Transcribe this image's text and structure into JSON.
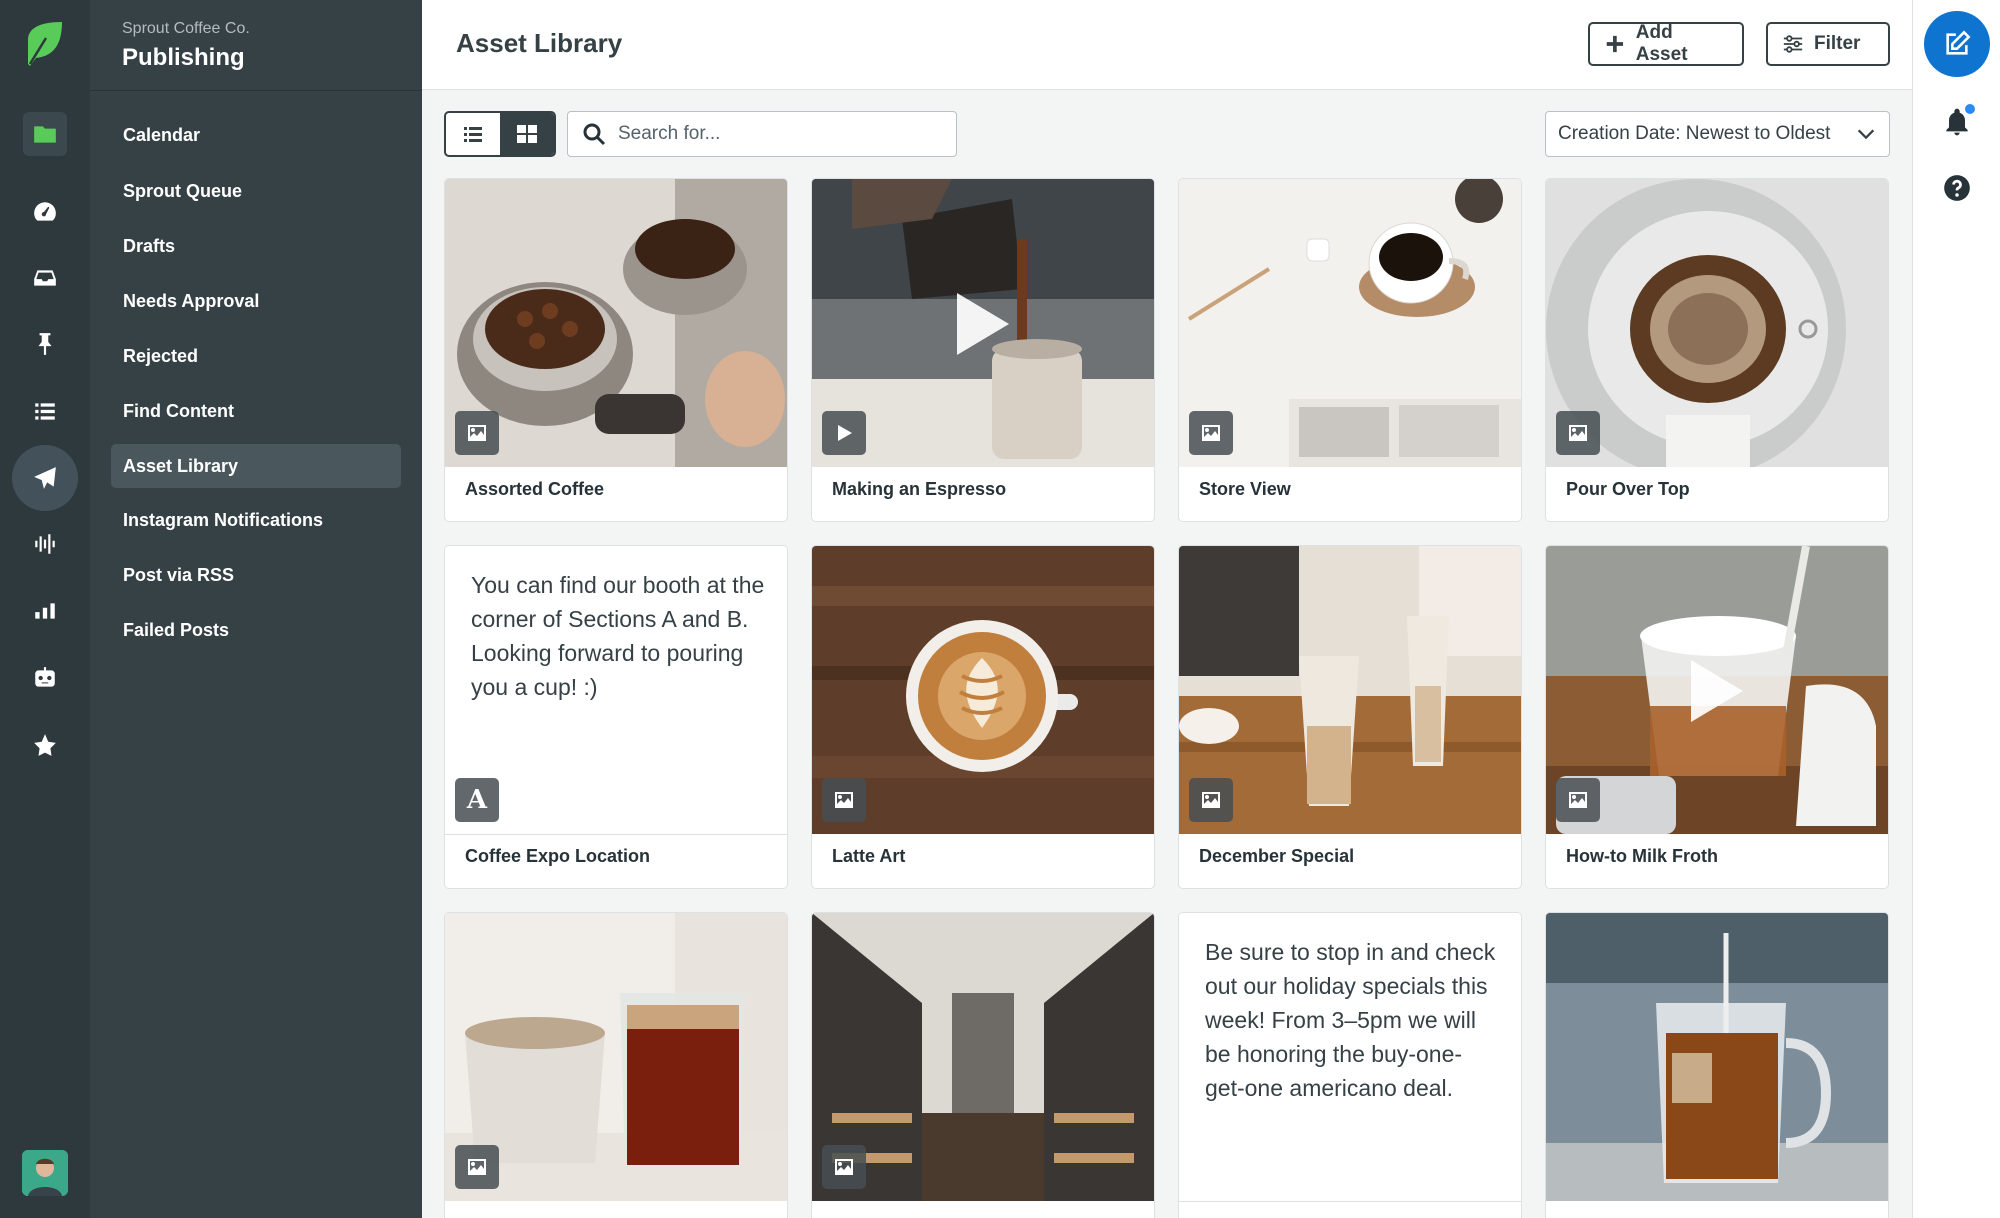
{
  "app": {
    "org_name": "Sprout Coffee Co.",
    "section_title": "Publishing"
  },
  "rail": {
    "icons": [
      "folder-icon",
      "dashboard-icon",
      "inbox-icon",
      "pin-icon",
      "list-icon",
      "send-icon",
      "listening-icon",
      "reports-icon",
      "bot-icon",
      "star-icon"
    ]
  },
  "nav": {
    "items": [
      {
        "label": "Calendar"
      },
      {
        "label": "Sprout Queue"
      },
      {
        "label": "Drafts"
      },
      {
        "label": "Needs Approval"
      },
      {
        "label": "Rejected"
      },
      {
        "label": "Find Content"
      },
      {
        "label": "Asset Library",
        "active": true
      },
      {
        "label": "Instagram Notifications"
      },
      {
        "label": "Post via RSS"
      },
      {
        "label": "Failed Posts"
      }
    ]
  },
  "header": {
    "title": "Asset Library",
    "add_label": "Add Asset",
    "filter_label": "Filter"
  },
  "toolbar": {
    "search_placeholder": "Search for...",
    "sort_value": "Creation Date: Newest to Oldest",
    "view_mode": "grid"
  },
  "assets": [
    {
      "title": "Assorted Coffee",
      "type": "image"
    },
    {
      "title": "Making an Espresso",
      "type": "video"
    },
    {
      "title": "Store View",
      "type": "image"
    },
    {
      "title": "Pour Over Top",
      "type": "image"
    },
    {
      "title": "Coffee Expo Location",
      "type": "text",
      "body": "You can find our booth at the corner of Sections A and B. Looking forward to pouring you a cup! :)",
      "badge": "A"
    },
    {
      "title": "Latte Art",
      "type": "image"
    },
    {
      "title": "December Special",
      "type": "image"
    },
    {
      "title": "How-to Milk Froth",
      "type": "video"
    },
    {
      "title": "",
      "type": "image"
    },
    {
      "title": "",
      "type": "image"
    },
    {
      "title": "",
      "type": "text",
      "body": "Be sure to stop in and check out our holiday specials this week! From 3–5pm we will be honoring the buy-one-get-one americano deal."
    },
    {
      "title": "",
      "type": "image"
    }
  ],
  "colors": {
    "rail_bg": "#2e393d",
    "subnav_bg": "#364146",
    "brand_green": "#59cb59",
    "compose_blue": "#0e74d0"
  }
}
